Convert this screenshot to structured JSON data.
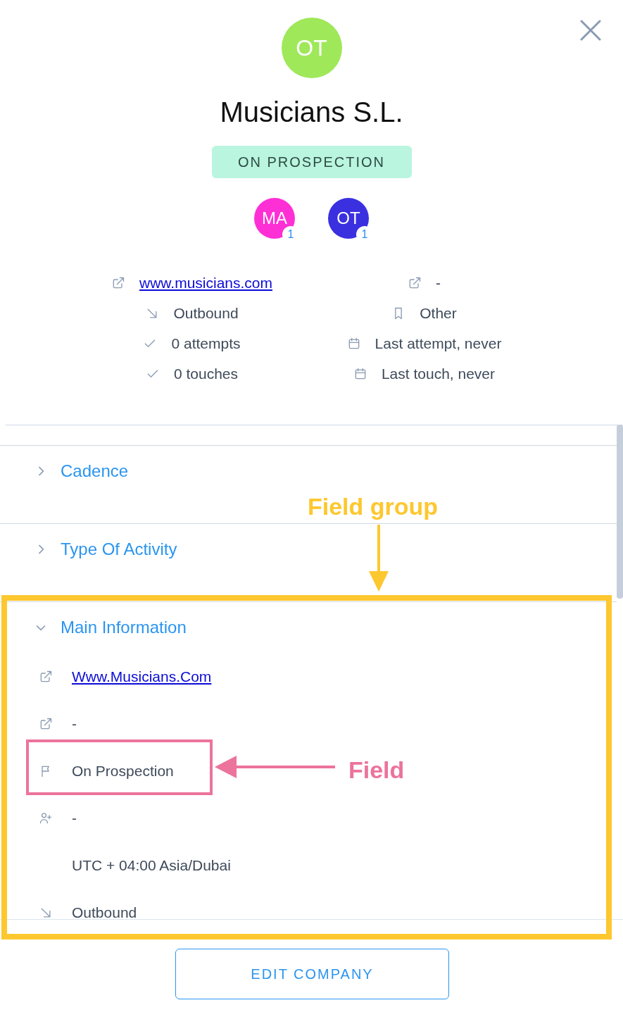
{
  "company": {
    "initials": "OT",
    "name": "Musicians S.L.",
    "status": "ON PROSPECTION"
  },
  "users": [
    {
      "initials": "MA",
      "count": "1",
      "color": "#ff2fd6"
    },
    {
      "initials": "OT",
      "count": "1",
      "color": "#3a30e0"
    }
  ],
  "stats": [
    {
      "kind": "website",
      "text": "www.musicians.com"
    },
    {
      "kind": "social",
      "text": "-"
    },
    {
      "kind": "source",
      "text": "Outbound"
    },
    {
      "kind": "category",
      "text": "Other"
    },
    {
      "kind": "attempts",
      "text": "0 attempts"
    },
    {
      "kind": "last_attempt",
      "text": "Last attempt, never"
    },
    {
      "kind": "touches",
      "text": "0 touches"
    },
    {
      "kind": "last_touch",
      "text": "Last touch, never"
    }
  ],
  "sections": [
    {
      "title": "Cadence",
      "expanded": false
    },
    {
      "title": "Type Of Activity",
      "expanded": false
    },
    {
      "title": "Main Information",
      "expanded": true,
      "fields": [
        {
          "kind": "website",
          "text": "Www.Musicians.Com"
        },
        {
          "kind": "social",
          "text": "-"
        },
        {
          "kind": "status",
          "text": "On Prospection"
        },
        {
          "kind": "owner",
          "text": "-"
        },
        {
          "kind": "timezone",
          "text": "UTC + 04:00 Asia/Dubai"
        },
        {
          "kind": "source",
          "text": "Outbound"
        }
      ]
    }
  ],
  "edit_button": "EDIT COMPANY",
  "annotations": [
    {
      "kind": "group",
      "text": "Field group"
    },
    {
      "kind": "field",
      "text": "Field"
    }
  ]
}
